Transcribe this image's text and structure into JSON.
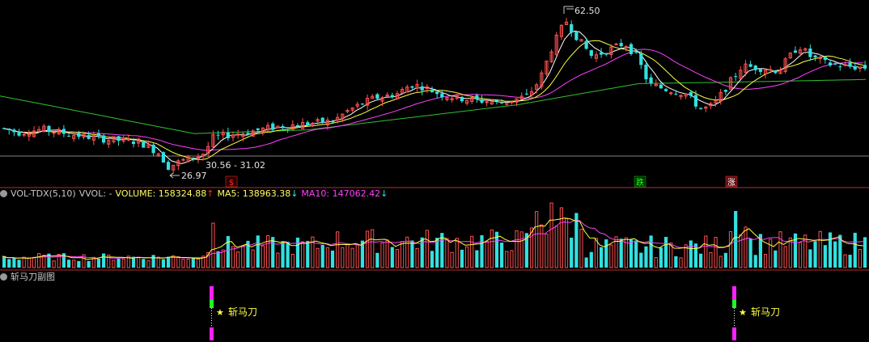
{
  "main_panel": {
    "high_label": "62.50",
    "low_label": "26.97",
    "range_label": "30.56 - 31.02",
    "markers": [
      {
        "text": "$",
        "color": "#ff3030",
        "bg": "#2a0000",
        "border": "#ff3030"
      },
      {
        "text": "跌",
        "color": "#22ff22",
        "bg": "#003300",
        "border": "#22aa22"
      },
      {
        "text": "涨",
        "color": "#ffffff",
        "bg": "#5a1010",
        "border": "#ff3030"
      }
    ]
  },
  "volume_panel": {
    "title": "VOL-TDX(5,10)",
    "vvol": "VVOL: -",
    "volume": "VOLUME: 158324.88",
    "ma5": "MA5: 138963.38",
    "ma10": "MA10: 147062.42",
    "colors": {
      "volume": "#ffff60",
      "ma5": "#ffffff",
      "ma10": "#ff40ff"
    }
  },
  "sub_panel": {
    "title": "斩马刀副图",
    "signal_label": "斩马刀",
    "signal_star": "★"
  },
  "colors": {
    "up": "#ff5050",
    "down": "#33e0e0",
    "ma_white": "#ffffff",
    "ma_yellow": "#ffff40",
    "ma_magenta": "#ff40ff",
    "ma_green": "#30c030",
    "divider": "#b03030",
    "grid": "#808080"
  },
  "chart_data": {
    "type": "candlestick",
    "series": [
      {
        "name": "VOLUME",
        "values_note": "bar heights follow candle sequence"
      }
    ],
    "price_high": 62.5,
    "price_low": 26.97,
    "highlight_range": [
      30.56,
      31.02
    ]
  }
}
